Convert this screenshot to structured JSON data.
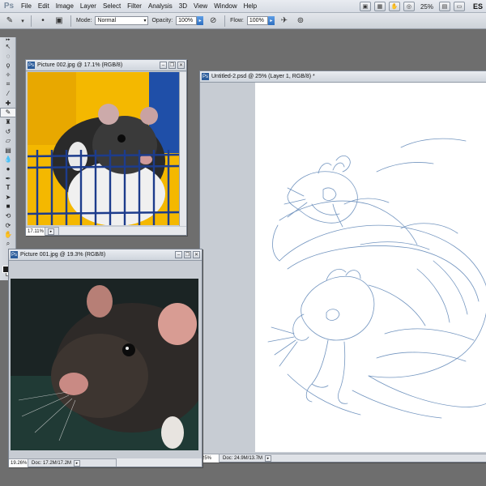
{
  "app": {
    "logo": "Ps"
  },
  "menu": {
    "items": [
      {
        "label": "File"
      },
      {
        "label": "Edit"
      },
      {
        "label": "Image"
      },
      {
        "label": "Layer"
      },
      {
        "label": "Select"
      },
      {
        "label": "Filter"
      },
      {
        "label": "Analysis"
      },
      {
        "label": "3D"
      },
      {
        "label": "View"
      },
      {
        "label": "Window"
      },
      {
        "label": "Help"
      }
    ],
    "zoom": "25%",
    "workspace": "ES"
  },
  "options": {
    "mode_label": "Mode:",
    "mode_value": "Normal",
    "opacity_label": "Opacity:",
    "opacity_value": "100%",
    "flow_label": "Flow:",
    "flow_value": "100%"
  },
  "windows": {
    "picture002": {
      "title": "Picture 002.jpg @ 17.1% (RGB/8)",
      "zoom": "17.11%"
    },
    "picture001": {
      "title": "Picture 001.jpg @ 19.3% (RGB/8)",
      "zoom": "19.26%",
      "docsize": "Doc: 17.2M/17.2M"
    },
    "untitled2": {
      "title": "Untitled-2.psd @ 25% (Layer 1, RGB/8) *",
      "zoom": "25%",
      "docsize": "Doc: 24.9M/13.7M"
    }
  },
  "colors": {
    "sketch": "#3f6ea3",
    "foreground": "#1c1c1c",
    "background": "#ffffff"
  },
  "toolbox": {
    "tools": [
      "move-icon",
      "marquee-icon",
      "lasso-icon",
      "quick-select-icon",
      "crop-icon",
      "eyedropper-icon",
      "healing-icon",
      "brush-icon",
      "clone-stamp-icon",
      "history-brush-icon",
      "eraser-icon",
      "gradient-icon",
      "blur-icon",
      "dodge-icon",
      "pen-icon",
      "type-icon",
      "path-select-icon",
      "shape-icon",
      "3d-rotate-icon",
      "3d-camera-icon",
      "hand-icon",
      "zoom-icon"
    ]
  }
}
